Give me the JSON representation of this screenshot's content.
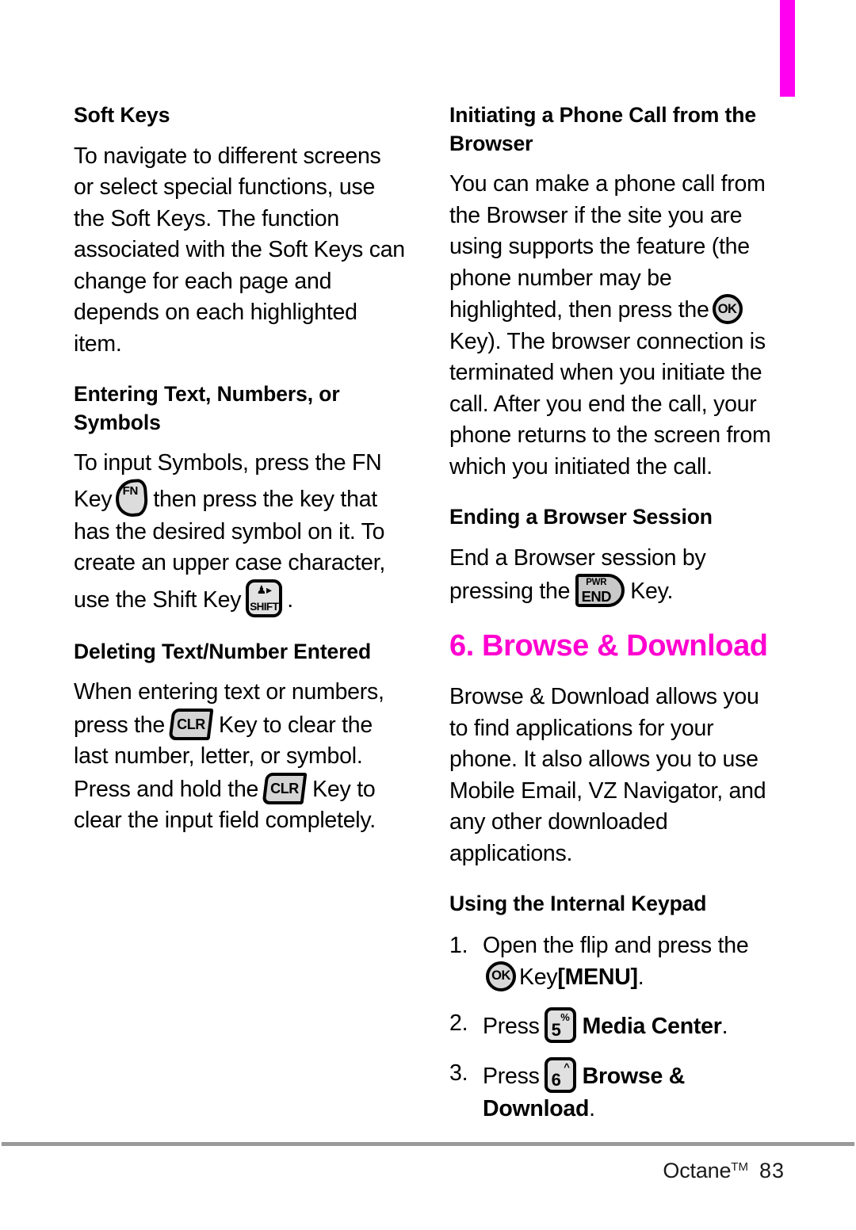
{
  "page": {
    "tab_marker_color": "#FF00F0",
    "chapter_heading_color": "#FF00D0"
  },
  "left_column": {
    "section1_heading": "Soft Keys",
    "section1_body": "To navigate to different screens or select special functions, use the Soft Keys. The function associated with the Soft Keys can change for each page and depends on each highlighted item.",
    "section2_heading": "Entering Text, Numbers, or Symbols",
    "section2_part1": "To input Symbols, press the FN Key",
    "section2_part2": "then press the key that has the desired symbol on it. To create an upper case character, use the Shift Key",
    "section2_part3": ".",
    "section3_heading": "Deleting Text/Number Entered",
    "section3_part1": "When entering text or numbers, press the",
    "section3_part2": "Key to clear the last number, letter, or symbol. Press and hold the",
    "section3_part3": "Key to clear the input field completely."
  },
  "right_column": {
    "section1_heading": "Initiating a Phone Call from the Browser",
    "section1_part1": "You can make a phone call from the Browser if the site you are using supports the feature (the phone number may be highlighted, then press the",
    "section1_part2": "Key). The browser connection is terminated when you initiate the call. After you end the call, your phone returns to the screen from which you initiated the call.",
    "section2_heading": "Ending a Browser Session",
    "section2_part1": "End a Browser session by pressing the",
    "section2_part2": "Key.",
    "chapter_heading": "6. Browse & Download",
    "chapter_body": "Browse & Download allows you to find applications for your phone. It also allows you to use Mobile Email, VZ Navigator, and any other downloaded applications.",
    "section3_heading": "Using the Internal Keypad",
    "steps": [
      {
        "num": "1.",
        "part1": "Open the flip and press the",
        "part2": "Key",
        "bold_tail": "[MENU]",
        "part3": "."
      },
      {
        "num": "2.",
        "part1": "Press",
        "bold_tail": "Media Center",
        "part3": "."
      },
      {
        "num": "3.",
        "part1": "Press",
        "bold_tail": "Browse & Download",
        "part3": "."
      }
    ]
  },
  "keys": {
    "ok": {
      "label": "OK"
    },
    "fn": {
      "label": "FN"
    },
    "shift": {
      "glyph": "♟▸",
      "label": "SHIFT"
    },
    "clr": {
      "label": "CLR"
    },
    "end": {
      "top_label": "PWR",
      "label": "END"
    },
    "num5": {
      "digit": "5",
      "superscript": "%"
    },
    "num6": {
      "digit": "6",
      "superscript": "^"
    }
  },
  "footer": {
    "product": "Octane",
    "trademark": "TM",
    "page_number": "83"
  }
}
